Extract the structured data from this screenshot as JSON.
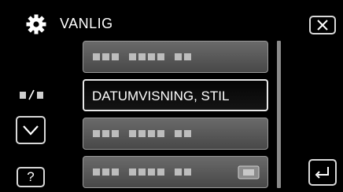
{
  "header": {
    "title": "VANLIG",
    "icon": "gear-icon"
  },
  "list": {
    "items": [
      {
        "label": "",
        "state": "greyed-out"
      },
      {
        "label": "DATUMVISNING, STIL",
        "state": "selected"
      },
      {
        "label": "",
        "state": "greyed-out"
      },
      {
        "label": "",
        "state": "greyed-out"
      }
    ]
  },
  "controls": {
    "close_icon": "close-icon",
    "down_icon": "chevron-down-icon",
    "help_label": "?",
    "back_icon": "return-icon"
  },
  "colors": {
    "background": "#000000",
    "item_gradient_top": "#6a6a6a",
    "item_gradient_bottom": "#484848",
    "frame": "#d8d8d8"
  }
}
